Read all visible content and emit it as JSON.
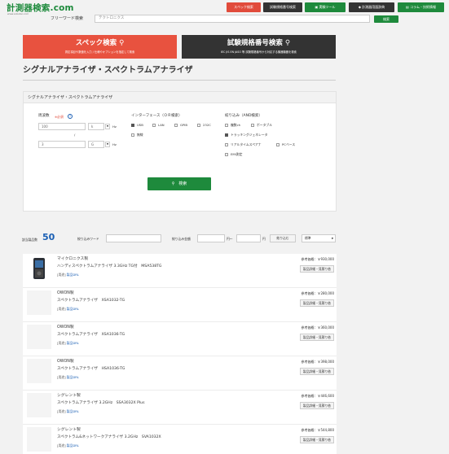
{
  "header": {
    "logo": "計測器検索.com",
    "logo_sub": "www.sokutei.com",
    "buttons": [
      {
        "label": "スペック検索",
        "color": "#e14b3b"
      },
      {
        "label": "試験規格番号検索",
        "color": "#333333"
      },
      {
        "label": "実験ツール",
        "color": "#1e8a3c"
      },
      {
        "label": "計測器用語辞典",
        "color": "#333333"
      },
      {
        "label": "コラム・技術情報",
        "color": "#1e8a3c"
      }
    ],
    "freeword_label": "フリーワード検索",
    "freeword_value": "テクトロニクス",
    "freeword_button": "検索"
  },
  "banners": {
    "spec": {
      "title": "スペック検索",
      "sub": "測定項目や数値を入力 / 仕様やオプションを指定して検索"
    },
    "standard": {
      "title": "試験規格番号検索",
      "sub": "IEC JIS EN JASO 等 試験規格番号から対応する機器機器を検索"
    }
  },
  "page_title": "シグナルアナライザ・スペクトラムアナライザ",
  "filter": {
    "heading": "シグナルアナライザ・スペクトラムアナライザ",
    "freq_label": "周波数",
    "freq_required": "※必須",
    "freq_min": "100",
    "freq_min_unit": "k",
    "freq_max": "3",
    "freq_max_unit": "G",
    "hz": "Hz",
    "slash": "/",
    "interface_label": "インターフェース（ＯＲ検索）",
    "interfaces": [
      {
        "label": "USB",
        "checked": true
      },
      {
        "label": "LAN",
        "checked": false
      },
      {
        "label": "GPIB",
        "checked": false
      },
      {
        "label": "232C",
        "checked": false
      },
      {
        "label": "無線",
        "checked": false
      }
    ],
    "narrow_label": "絞り込み（AND検索）",
    "narrow": [
      {
        "label": "複数ch",
        "checked": false
      },
      {
        "label": "ポータブル",
        "checked": false
      },
      {
        "label": "トラッキングジェネレータ",
        "checked": true
      },
      {
        "label": "リアルタイムスペアナ",
        "checked": false
      },
      {
        "label": "PCベース",
        "checked": false
      },
      {
        "label": "EMI測定",
        "checked": false
      }
    ],
    "search_button": "検索"
  },
  "results": {
    "count_label": "該当製品数",
    "count": "50",
    "narrow_word_label": "絞り込みワード",
    "price_label": "絞り込み金額",
    "yen": "円",
    "tilde": "円～",
    "narrow_button": "絞り込む",
    "sort_value": "標準"
  },
  "products": [
    {
      "maker": "マイクロニクス製",
      "name": "ハンディスペクトラムアナライザ 3.3GHz TG付　MSA538TG",
      "price": "参考価格：￥930,000",
      "tag": "[用途]",
      "tag_link": "製品DRL",
      "detail": "製品詳細・見積り依",
      "has_image": true
    },
    {
      "maker": "OWON製",
      "name": "スペクトラムアナライザ　XSA1032-TG",
      "price": "参考価格：￥280,000",
      "tag": "[用途]",
      "tag_link": "製品DRL",
      "detail": "製品詳細・見積り依",
      "has_image": false
    },
    {
      "maker": "OWON製",
      "name": "スペクトラムアナライザ　XSA1036-TG",
      "price": "参考価格：￥360,000",
      "tag": "[用途]",
      "tag_link": "製品DRL",
      "detail": "製品詳細・見積り依",
      "has_image": false
    },
    {
      "maker": "OWON製",
      "name": "スペクトラムアナライザ　HSA1036-TG",
      "price": "参考価格：￥398,000",
      "tag": "[用途]",
      "tag_link": "製品DRL",
      "detail": "製品詳細・見積り依",
      "has_image": false
    },
    {
      "maker": "シグレント製",
      "name": "スペクトラムアナライザ 3.2GHz　SSA3032X Plus",
      "price": "参考価格：￥446,600",
      "tag": "[用途]",
      "tag_link": "製品DRL",
      "detail": "製品詳細・見積り依",
      "has_image": false
    },
    {
      "maker": "シグレント製",
      "name": "スペクトラム&ネットワークアナライザ 3.2GHz　SVA1032X",
      "price": "参考価格：￥544,800",
      "tag": "[用途]",
      "tag_link": "製品DRL",
      "detail": "製品詳細・見積り依",
      "has_image": false
    }
  ]
}
